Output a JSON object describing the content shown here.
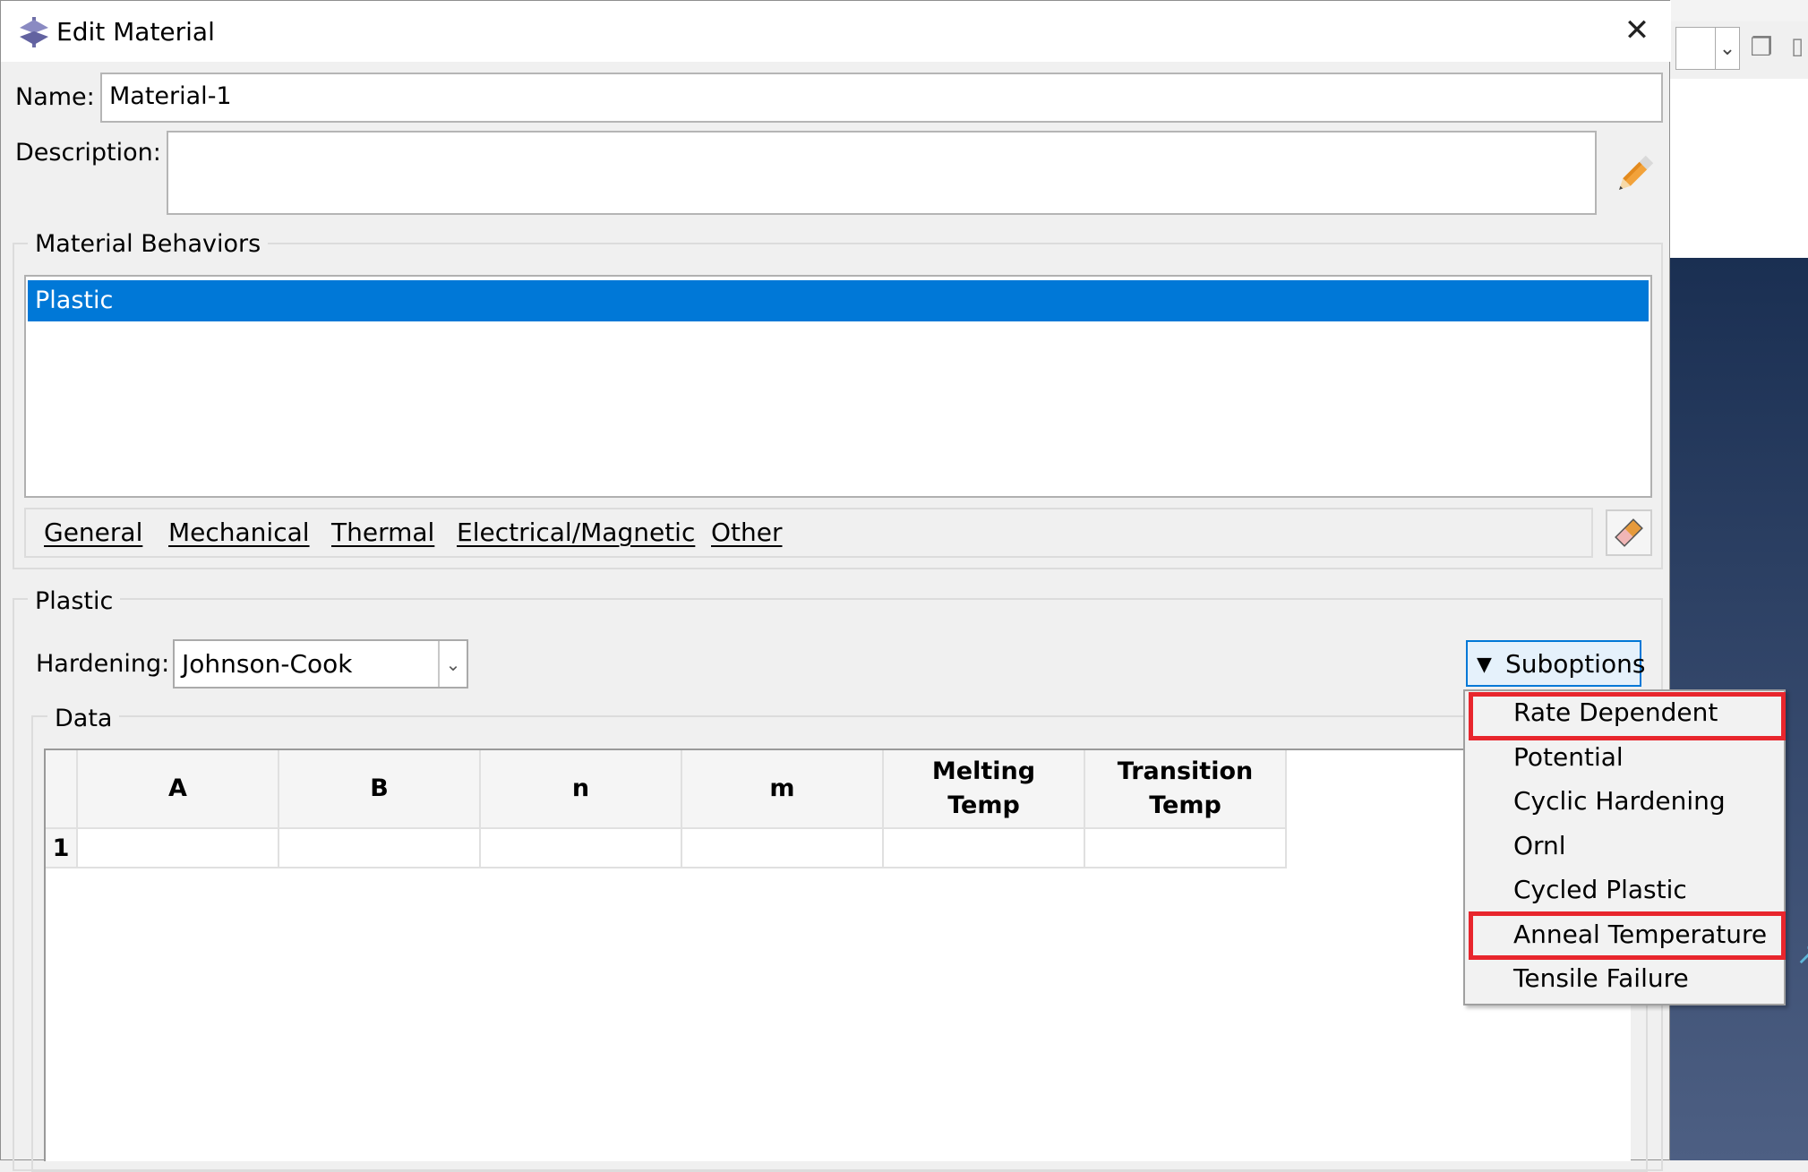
{
  "dialog": {
    "title": "Edit Material",
    "close_symbol": "✕",
    "icon": "material-app-icon"
  },
  "name": {
    "label": "Name:",
    "value": "Material-1"
  },
  "description": {
    "label": "Description:",
    "value": "",
    "edit_icon": "pencil-icon"
  },
  "behaviors": {
    "group_label": "Material Behaviors",
    "items": [
      "Plastic"
    ],
    "selected_color": "#0078d7"
  },
  "menubar": {
    "items": [
      "General",
      "Mechanical",
      "Thermal",
      "Electrical/Magnetic",
      "Other"
    ],
    "delete_icon": "eraser-icon"
  },
  "plastic": {
    "group_label": "Plastic",
    "hardening_label": "Hardening:",
    "hardening_value": "Johnson-Cook",
    "suboptions_label": "Suboptions",
    "data_label": "Data"
  },
  "table": {
    "columns": [
      [
        "A"
      ],
      [
        "B"
      ],
      [
        "n"
      ],
      [
        "m"
      ],
      [
        "Melting",
        "Temp"
      ],
      [
        "Transition",
        "Temp"
      ]
    ],
    "rows": [
      {
        "index": "1",
        "cells": [
          "",
          "",
          "",
          "",
          "",
          ""
        ]
      }
    ]
  },
  "suboptions_menu": {
    "items": [
      "Rate Dependent",
      "Potential",
      "Cyclic Hardening",
      "Ornl",
      "Cycled Plastic",
      "Anneal Temperature",
      "Tensile Failure"
    ],
    "highlighted": [
      "Rate Dependent",
      "Anneal Temperature"
    ],
    "highlight_color": "#e8262d"
  }
}
